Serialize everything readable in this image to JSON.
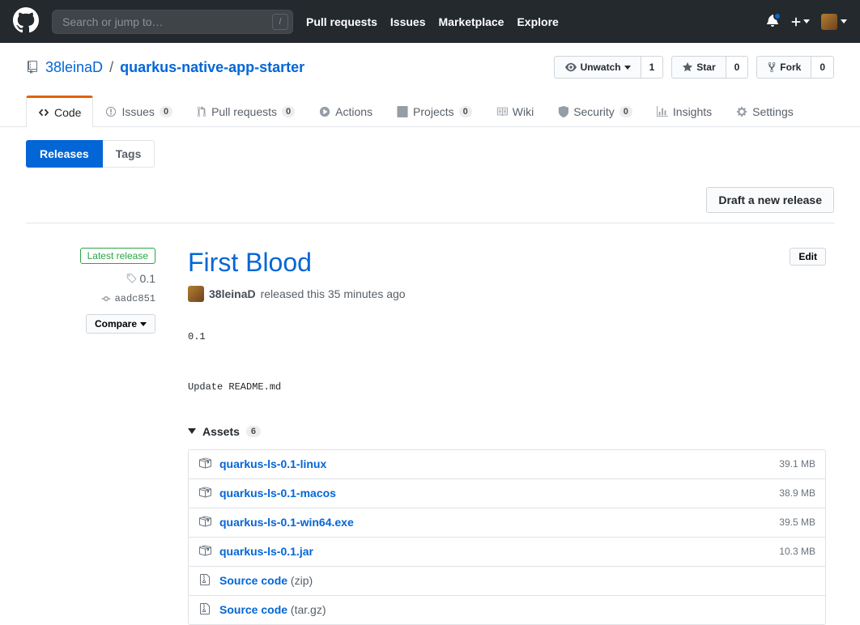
{
  "header": {
    "search_placeholder": "Search or jump to…",
    "nav": [
      "Pull requests",
      "Issues",
      "Marketplace",
      "Explore"
    ]
  },
  "repo": {
    "owner": "38leinaD",
    "name": "quarkus-native-app-starter",
    "actions": {
      "unwatch_label": "Unwatch",
      "unwatch_count": "1",
      "star_label": "Star",
      "star_count": "0",
      "fork_label": "Fork",
      "fork_count": "0"
    }
  },
  "nav": {
    "code": "Code",
    "issues": "Issues",
    "issues_count": "0",
    "pulls": "Pull requests",
    "pulls_count": "0",
    "actions": "Actions",
    "projects": "Projects",
    "projects_count": "0",
    "wiki": "Wiki",
    "security": "Security",
    "security_count": "0",
    "insights": "Insights",
    "settings": "Settings"
  },
  "subnav": {
    "releases": "Releases",
    "tags": "Tags",
    "draft_btn": "Draft a new release"
  },
  "release": {
    "latest_label": "Latest release",
    "tag": "0.1",
    "sha": "aadc851",
    "compare_label": "Compare",
    "title": "First Blood",
    "edit_label": "Edit",
    "author": "38leinaD",
    "released_text": "released this 35 minutes ago",
    "notes": "0.1\n\nUpdate README.md",
    "assets_label": "Assets",
    "assets_count": "6",
    "assets": [
      {
        "name": "quarkus-ls-0.1-linux",
        "size": "39.1 MB",
        "type": "pkg"
      },
      {
        "name": "quarkus-ls-0.1-macos",
        "size": "38.9 MB",
        "type": "pkg"
      },
      {
        "name": "quarkus-ls-0.1-win64.exe",
        "size": "39.5 MB",
        "type": "pkg"
      },
      {
        "name": "quarkus-ls-0.1.jar",
        "size": "10.3 MB",
        "type": "pkg"
      },
      {
        "name": "Source code",
        "sub": "(zip)",
        "type": "zip"
      },
      {
        "name": "Source code",
        "sub": "(tar.gz)",
        "type": "zip"
      }
    ]
  }
}
